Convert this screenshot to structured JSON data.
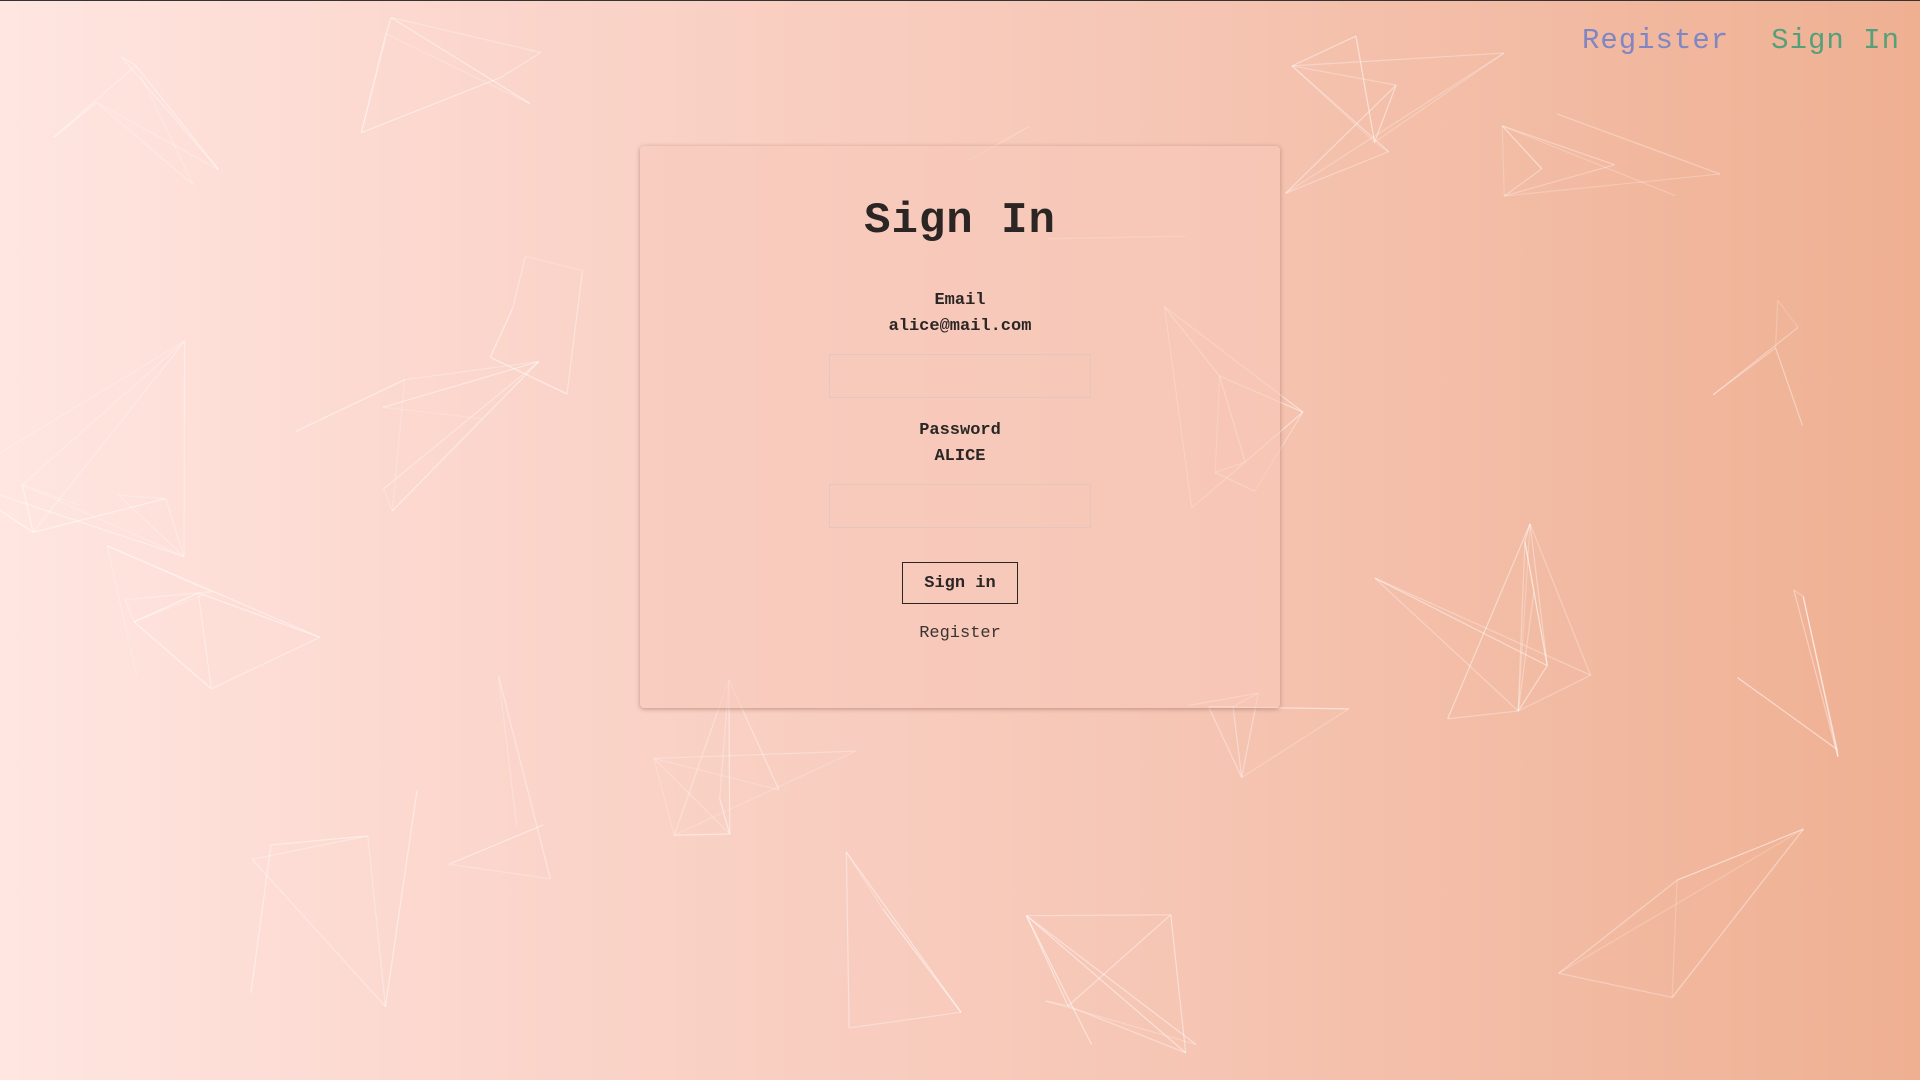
{
  "topnav": {
    "register_label": "Register",
    "signin_label": "Sign In"
  },
  "colors": {
    "nav_register": "#7e86c4",
    "nav_signin": "#55a07a",
    "background_left": "#ffe6e1",
    "background_right": "#efb092"
  },
  "form": {
    "title": "Sign In",
    "email_label": "Email",
    "email_hint": "alice@mail.com",
    "email_value": "",
    "password_label": "Password",
    "password_hint": "ALICE",
    "password_value": "",
    "submit_label": "Sign in",
    "register_link": "Register"
  }
}
